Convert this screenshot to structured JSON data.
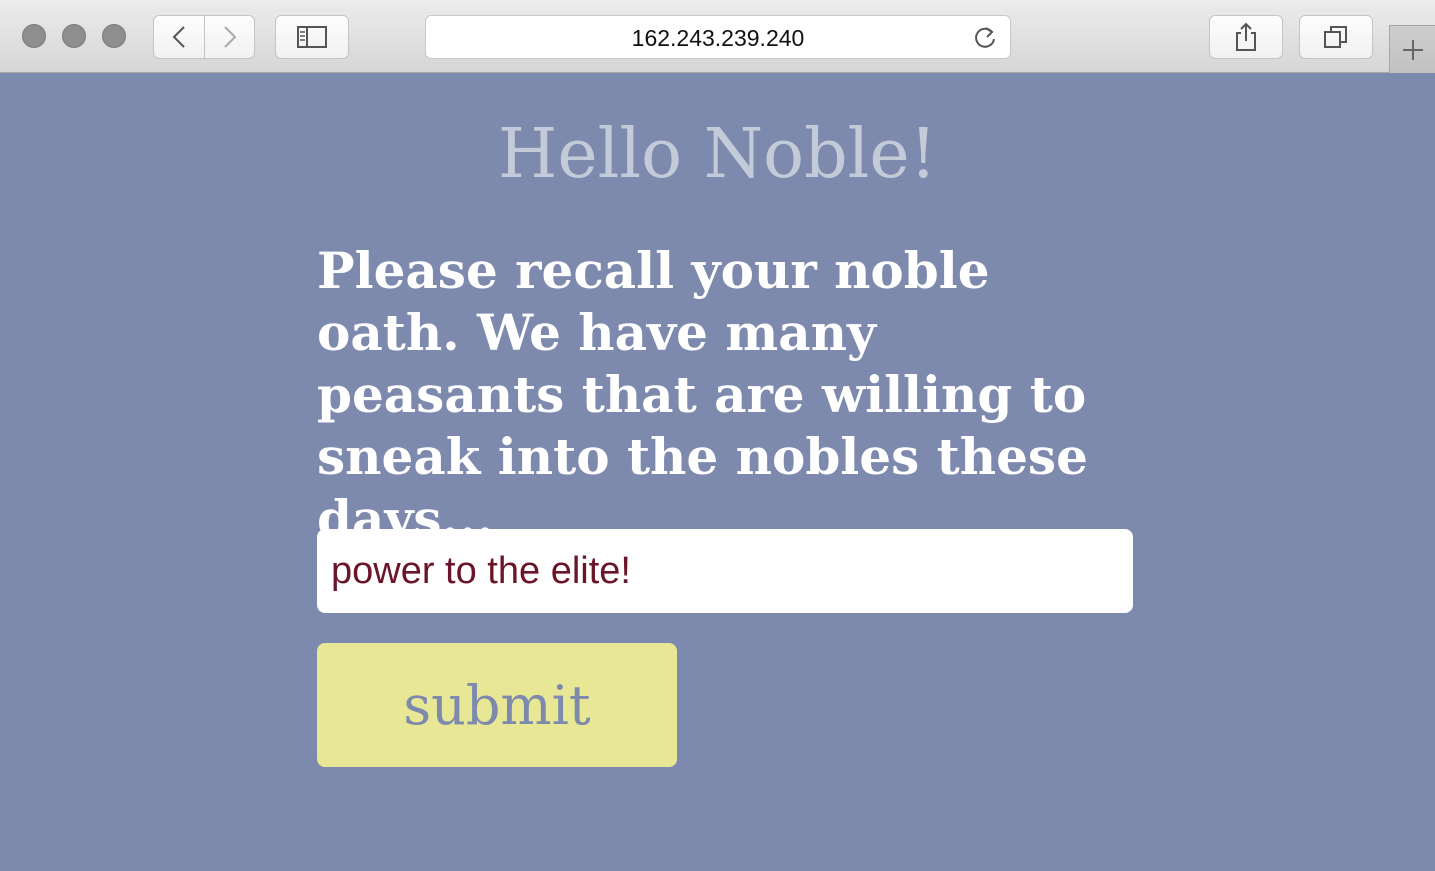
{
  "browser": {
    "url": "162.243.239.240",
    "icons": {
      "back": "chevron-left-icon",
      "forward": "chevron-right-icon",
      "sidebar": "sidebar-icon",
      "reload": "reload-icon",
      "share": "share-icon",
      "tabs": "tabs-overview-icon",
      "new_tab": "plus-icon"
    }
  },
  "page": {
    "heading": "Hello Noble!",
    "prompt": "Please recall your noble oath. We have many peasants that are willing to sneak into the nobles these days...",
    "oath_input_value": "power to the elite!",
    "submit_label": "submit"
  },
  "colors": {
    "background": "#7d8aad",
    "heading": "#c4cbd8",
    "input_text": "#6b1528",
    "submit_bg": "#e8e796"
  }
}
